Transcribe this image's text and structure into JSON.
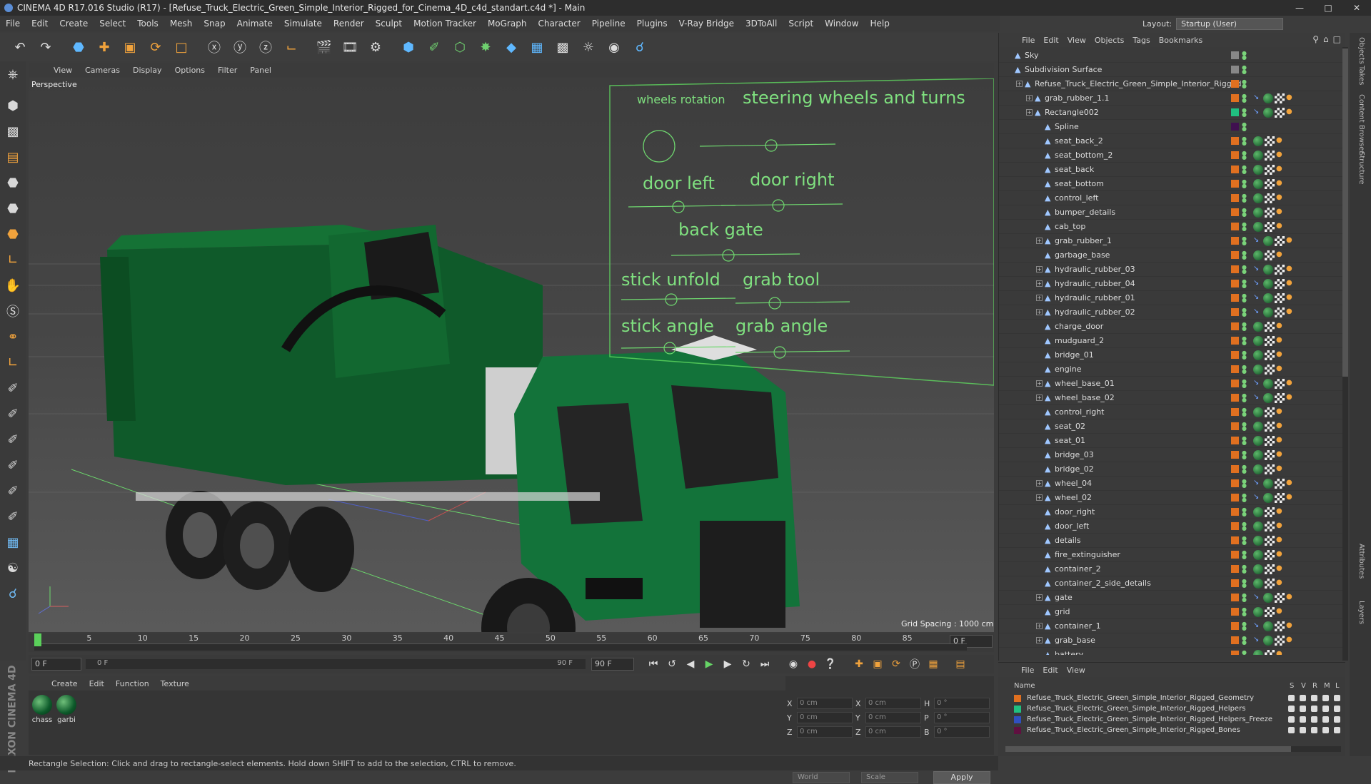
{
  "window": {
    "title": "CINEMA 4D R17.016 Studio (R17) - [Refuse_Truck_Electric_Green_Simple_Interior_Rigged_for_Cinema_4D_c4d_standart.c4d *] - Main"
  },
  "menu": [
    "File",
    "Edit",
    "Create",
    "Select",
    "Tools",
    "Mesh",
    "Snap",
    "Animate",
    "Simulate",
    "Render",
    "Sculpt",
    "Motion Tracker",
    "MoGraph",
    "Character",
    "Pipeline",
    "Plugins",
    "V-Ray Bridge",
    "3DToAll",
    "Script",
    "Window",
    "Help"
  ],
  "layout": {
    "label": "Layout:",
    "value": "Startup (User)"
  },
  "viewport": {
    "menu": [
      "View",
      "Cameras",
      "Display",
      "Options",
      "Filter",
      "Panel"
    ],
    "label": "Perspective",
    "grid_spacing": "Grid Spacing : 1000 cm",
    "rig_labels": {
      "wheels_rotation": "wheels rotation",
      "steering": "steering wheels and turns",
      "door_left": "door left",
      "door_right": "door right",
      "back_gate": "back gate",
      "stick_unfold": "stick unfold",
      "grab_tool": "grab tool",
      "stick_angle": "stick angle",
      "grab_angle": "grab angle"
    }
  },
  "timeline": {
    "ticks": [
      "0",
      "5",
      "10",
      "15",
      "20",
      "25",
      "30",
      "35",
      "40",
      "45",
      "50",
      "55",
      "60",
      "65",
      "70",
      "75",
      "80",
      "85",
      "90"
    ],
    "end_frame": "0 F"
  },
  "transport": {
    "start": "0 F",
    "range_start": "0 F",
    "range_end": "90 F",
    "end": "90 F"
  },
  "materials": {
    "menu": [
      "Create",
      "Edit",
      "Function",
      "Texture"
    ],
    "items": [
      "chass",
      "garbi"
    ]
  },
  "coords": {
    "x": "0 cm",
    "y": "0 cm",
    "z": "0 cm",
    "h": "0 °",
    "p": "0 °",
    "b": "0 °",
    "mode1": "World",
    "mode2": "Scale",
    "apply": "Apply"
  },
  "status": "Rectangle Selection: Click and drag to rectangle-select elements. Hold down SHIFT to add to the selection, CTRL to remove.",
  "maxon": "MAXON CINEMA 4D",
  "objects": {
    "menu": [
      "File",
      "Edit",
      "View",
      "Objects",
      "Tags",
      "Bookmarks"
    ],
    "rows": [
      {
        "name": "Sky",
        "indent": 0,
        "plus": false,
        "color": "#888888"
      },
      {
        "name": "Subdivision Surface",
        "indent": 0,
        "plus": false,
        "color": "#888888"
      },
      {
        "name": "Refuse_Truck_Electric_Green_Simple_Interior_Rigged",
        "indent": 1,
        "plus": true,
        "color": "#e07020"
      },
      {
        "name": "grab_rubber_1.1",
        "indent": 2,
        "plus": true,
        "color": "#e07020"
      },
      {
        "name": "Rectangle002",
        "indent": 2,
        "plus": true,
        "color": "#20c080"
      },
      {
        "name": "Spline",
        "indent": 3,
        "plus": false,
        "color": "#401050"
      },
      {
        "name": "seat_back_2",
        "indent": 3,
        "plus": false,
        "color": "#e07020"
      },
      {
        "name": "seat_bottom_2",
        "indent": 3,
        "plus": false,
        "color": "#e07020"
      },
      {
        "name": "seat_back",
        "indent": 3,
        "plus": false,
        "color": "#e07020"
      },
      {
        "name": "seat_bottom",
        "indent": 3,
        "plus": false,
        "color": "#e07020"
      },
      {
        "name": "control_left",
        "indent": 3,
        "plus": false,
        "color": "#e07020"
      },
      {
        "name": "bumper_details",
        "indent": 3,
        "plus": false,
        "color": "#e07020"
      },
      {
        "name": "cab_top",
        "indent": 3,
        "plus": false,
        "color": "#e07020"
      },
      {
        "name": "grab_rubber_1",
        "indent": 3,
        "plus": true,
        "color": "#e07020"
      },
      {
        "name": "garbage_base",
        "indent": 3,
        "plus": false,
        "color": "#e07020"
      },
      {
        "name": "hydraulic_rubber_03",
        "indent": 3,
        "plus": true,
        "color": "#e07020"
      },
      {
        "name": "hydraulic_rubber_04",
        "indent": 3,
        "plus": true,
        "color": "#e07020"
      },
      {
        "name": "hydraulic_rubber_01",
        "indent": 3,
        "plus": true,
        "color": "#e07020"
      },
      {
        "name": "hydraulic_rubber_02",
        "indent": 3,
        "plus": true,
        "color": "#e07020"
      },
      {
        "name": "charge_door",
        "indent": 3,
        "plus": false,
        "color": "#e07020"
      },
      {
        "name": "mudguard_2",
        "indent": 3,
        "plus": false,
        "color": "#e07020"
      },
      {
        "name": "bridge_01",
        "indent": 3,
        "plus": false,
        "color": "#e07020"
      },
      {
        "name": "engine",
        "indent": 3,
        "plus": false,
        "color": "#e07020"
      },
      {
        "name": "wheel_base_01",
        "indent": 3,
        "plus": true,
        "color": "#e07020"
      },
      {
        "name": "wheel_base_02",
        "indent": 3,
        "plus": true,
        "color": "#e07020"
      },
      {
        "name": "control_right",
        "indent": 3,
        "plus": false,
        "color": "#e07020"
      },
      {
        "name": "seat_02",
        "indent": 3,
        "plus": false,
        "color": "#e07020"
      },
      {
        "name": "seat_01",
        "indent": 3,
        "plus": false,
        "color": "#e07020"
      },
      {
        "name": "bridge_03",
        "indent": 3,
        "plus": false,
        "color": "#e07020"
      },
      {
        "name": "bridge_02",
        "indent": 3,
        "plus": false,
        "color": "#e07020"
      },
      {
        "name": "wheel_04",
        "indent": 3,
        "plus": true,
        "color": "#e07020"
      },
      {
        "name": "wheel_02",
        "indent": 3,
        "plus": true,
        "color": "#e07020"
      },
      {
        "name": "door_right",
        "indent": 3,
        "plus": false,
        "color": "#e07020"
      },
      {
        "name": "door_left",
        "indent": 3,
        "plus": false,
        "color": "#e07020"
      },
      {
        "name": "details",
        "indent": 3,
        "plus": false,
        "color": "#e07020"
      },
      {
        "name": "fire_extinguisher",
        "indent": 3,
        "plus": false,
        "color": "#e07020"
      },
      {
        "name": "container_2",
        "indent": 3,
        "plus": false,
        "color": "#e07020"
      },
      {
        "name": "container_2_side_details",
        "indent": 3,
        "plus": false,
        "color": "#e07020"
      },
      {
        "name": "gate",
        "indent": 3,
        "plus": true,
        "color": "#e07020"
      },
      {
        "name": "grid",
        "indent": 3,
        "plus": false,
        "color": "#e07020"
      },
      {
        "name": "container_1",
        "indent": 3,
        "plus": true,
        "color": "#e07020"
      },
      {
        "name": "grab_base",
        "indent": 3,
        "plus": true,
        "color": "#e07020"
      },
      {
        "name": "battery",
        "indent": 3,
        "plus": false,
        "color": "#e07020"
      }
    ]
  },
  "layers": {
    "menu": [
      "File",
      "Edit",
      "View"
    ],
    "header": {
      "name": "Name",
      "s": "S",
      "v": "V",
      "r": "R",
      "m": "M",
      "l": "L"
    },
    "rows": [
      {
        "name": "Refuse_Truck_Electric_Green_Simple_Interior_Rigged_Geometry",
        "color": "#e07020"
      },
      {
        "name": "Refuse_Truck_Electric_Green_Simple_Interior_Rigged_Helpers",
        "color": "#20c080"
      },
      {
        "name": "Refuse_Truck_Electric_Green_Simple_Interior_Rigged_Helpers_Freeze",
        "color": "#3050c0"
      },
      {
        "name": "Refuse_Truck_Electric_Green_Simple_Interior_Rigged_Bones",
        "color": "#601040"
      }
    ]
  },
  "right_tabs": [
    "Objects",
    "Takes",
    "Content Browser",
    "Structure",
    "Attributes",
    "Layers"
  ]
}
